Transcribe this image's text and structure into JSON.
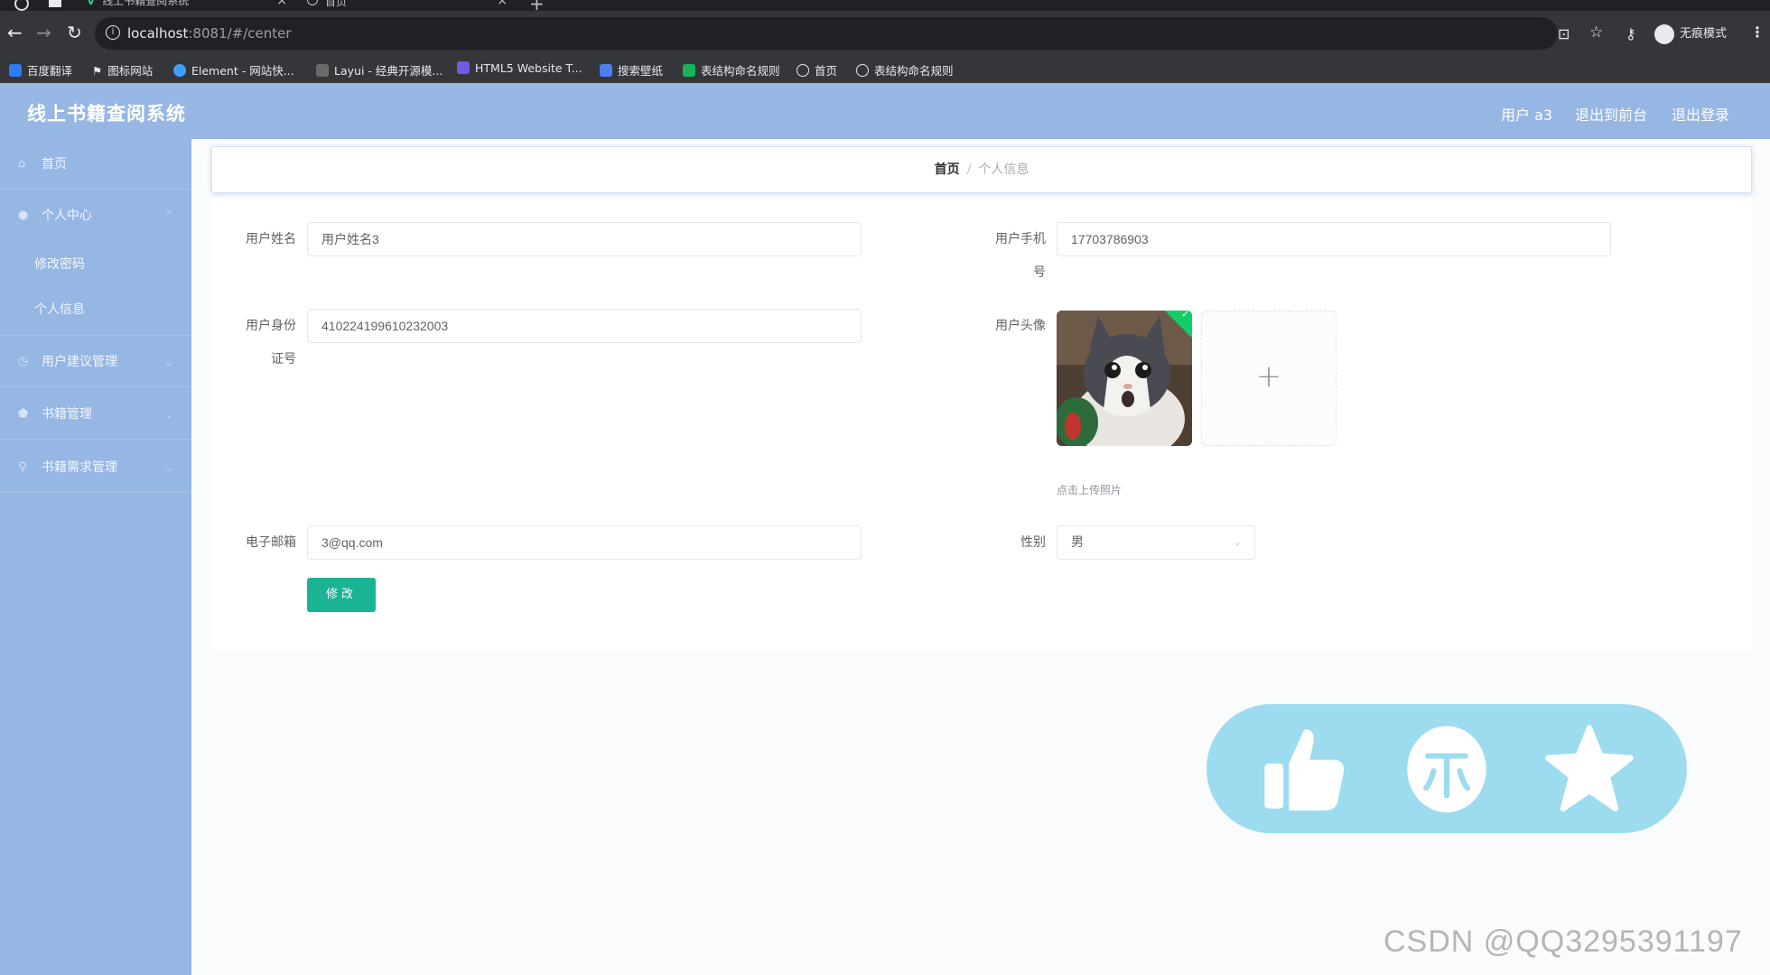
{
  "browser": {
    "tabs": [
      {
        "title": "线上书籍查阅系统"
      },
      {
        "title": "首页"
      }
    ],
    "url_host": "localhost",
    "url_rest": ":8081/#/center",
    "profile_label": "无痕模式",
    "bookmarks": [
      {
        "label": "百度翻译",
        "color": "#2f7cf6"
      },
      {
        "label": "图标网站",
        "color": "#ffffff"
      },
      {
        "label": "Element - 网站快...",
        "color": "#409eff"
      },
      {
        "label": "Layui - 经典开源模...",
        "color": "#cfcfcf"
      },
      {
        "label": "HTML5 Website T...",
        "color": "#6f5ce6"
      },
      {
        "label": "搜索壁纸",
        "color": "#4f7ef0"
      },
      {
        "label": "表结构命名规则",
        "color": "#19b35b"
      },
      {
        "label": "首页",
        "color": "#e8eaed"
      },
      {
        "label": "表结构命名规则",
        "color": "#e8eaed"
      }
    ]
  },
  "header": {
    "title": "线上书籍查阅系统",
    "user": "用户 a3",
    "back_to_front": "退出到前台",
    "logout": "退出登录"
  },
  "sidebar": {
    "items": [
      {
        "label": "首页",
        "icon": "home-icon"
      },
      {
        "label": "个人中心",
        "icon": "user-icon"
      },
      {
        "label": "修改密码",
        "icon": ""
      },
      {
        "label": "个人信息",
        "icon": ""
      },
      {
        "label": "用户建议管理",
        "icon": "clock-icon"
      },
      {
        "label": "书籍管理",
        "icon": "shield-icon"
      },
      {
        "label": "书籍需求管理",
        "icon": "location-icon"
      }
    ]
  },
  "breadcrumb": {
    "home": "首页",
    "separator": "/",
    "current": "个人信息"
  },
  "form": {
    "name_label": "用户姓名",
    "name_value": "用户姓名3",
    "phone_label_1": "用户手机",
    "phone_label_2": "号",
    "phone_value": "17703786903",
    "idcard_label_1": "用户身份",
    "idcard_label_2": "证号",
    "idcard_value": "410224199610232003",
    "avatar_label": "用户头像",
    "upload_tip": "点击上传照片",
    "email_label": "电子邮箱",
    "email_value": "3@qq.com",
    "gender_label": "性别",
    "gender_value": "男",
    "submit_label": "修改"
  },
  "watermark": "CSDN @QQ3295391197",
  "colors": {
    "accent": "#96b6e4",
    "button": "#1ab394",
    "overlay": "#9ddcef"
  }
}
